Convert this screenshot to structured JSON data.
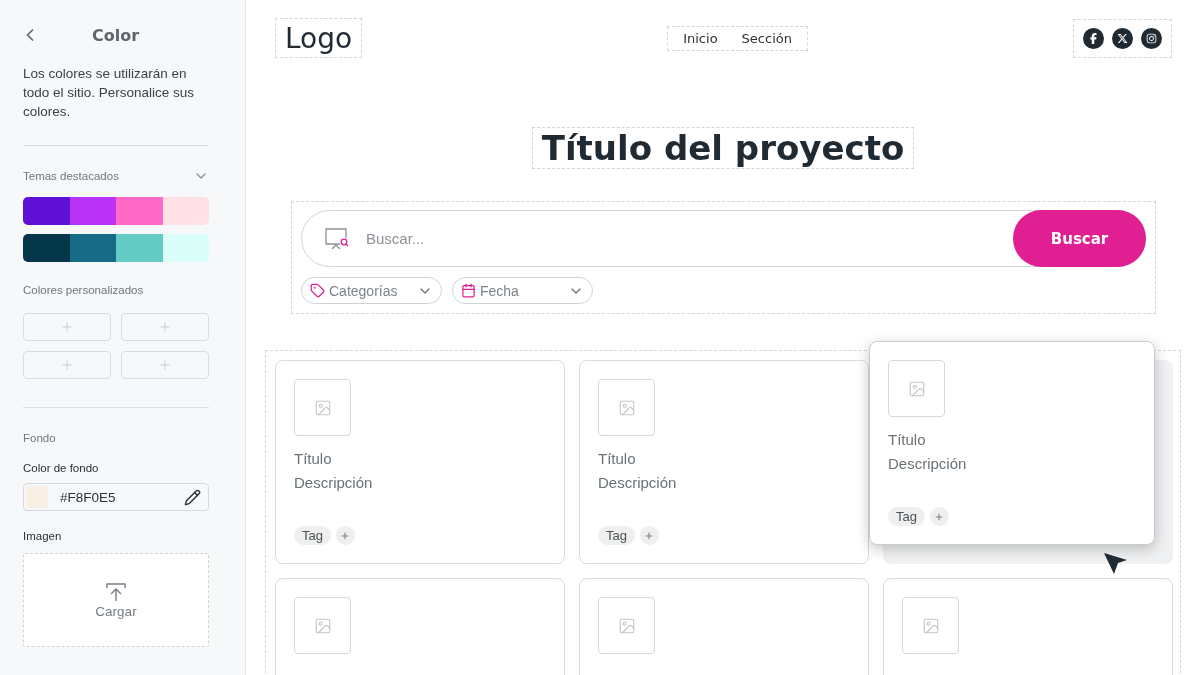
{
  "sidebar": {
    "title": "Color",
    "description": "Los colores se utilizarán en todo el sitio. Personalice sus colores.",
    "featured_themes": {
      "label": "Temas destacados",
      "themes": [
        {
          "swatches": [
            {
              "color": "#5e10d4"
            },
            {
              "color": "#b833f5"
            },
            {
              "color": "#ff69c6"
            },
            {
              "color": "#ffe0e6"
            }
          ]
        },
        {
          "swatches": [
            {
              "color": "#04364a"
            },
            {
              "color": "#176b87"
            },
            {
              "color": "#64ccc5"
            },
            {
              "color": "#dafffb"
            }
          ]
        }
      ]
    },
    "custom_colors": {
      "label": "Colores personalizados",
      "slots": [
        {
          "kind": "empty"
        },
        {
          "kind": "empty"
        },
        {
          "kind": "empty"
        },
        {
          "kind": "empty"
        }
      ]
    },
    "background": {
      "heading": "Fondo",
      "color_label": "Color de fondo",
      "color_value": "#F8F0E5",
      "image_label": "Imagen",
      "upload_label": "Cargar"
    }
  },
  "header": {
    "logo": "Logo",
    "nav": [
      {
        "label": "Inicio"
      },
      {
        "label": "Sección"
      }
    ]
  },
  "project_title": "Título del proyecto",
  "search": {
    "placeholder": "Buscar...",
    "button": "Buscar",
    "filters": [
      {
        "kind": "category",
        "label": "Categorías"
      },
      {
        "kind": "date",
        "label": "Fecha"
      }
    ]
  },
  "cards": [
    {
      "title": "Título",
      "description": "Descripción",
      "tag": "Tag",
      "dragging": false
    },
    {
      "title": "Título",
      "description": "Descripción",
      "tag": "Tag",
      "dragging": false
    },
    {
      "title": "Título",
      "description": "Descripción",
      "tag": "Tag",
      "dragging": true
    },
    {
      "dragging": false
    },
    {
      "dragging": false
    },
    {
      "dragging": false
    }
  ]
}
